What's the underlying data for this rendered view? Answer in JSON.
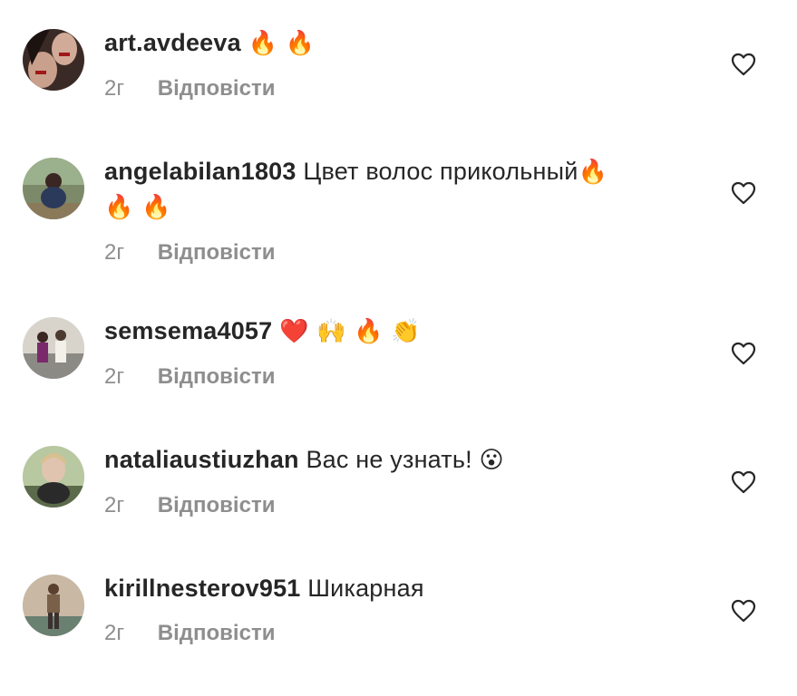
{
  "comments": [
    {
      "username": "art.avdeeva",
      "text": "",
      "emoji": "🔥 🔥",
      "time": "2г",
      "reply": "Відповісти"
    },
    {
      "username": "angelabilan1803",
      "text": "Цвет волос прикольный",
      "emoji": "🔥",
      "emoji2": "🔥 🔥",
      "time": "2г",
      "reply": "Відповісти"
    },
    {
      "username": "semsema4057",
      "text": "",
      "emoji": "❤️ 🙌 🔥 👏",
      "time": "2г",
      "reply": "Відповісти"
    },
    {
      "username": "nataliaustiuzhan",
      "text": "Вас не узнать!",
      "emoji": "😮",
      "time": "2г",
      "reply": "Відповісти"
    },
    {
      "username": "kirillnesterov951",
      "text": "Шикарная",
      "emoji": "",
      "time": "2г",
      "reply": "Відповісти"
    }
  ],
  "icons": {
    "like": "heart-outline-icon"
  }
}
